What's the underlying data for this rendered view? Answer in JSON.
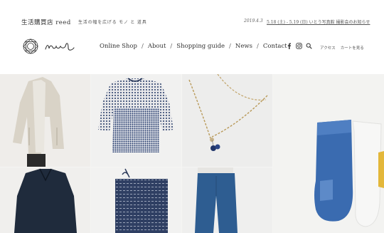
{
  "header": {
    "shop_name": "生活購買店 reed",
    "tagline": "生活の幅を広げる モノ と 道具",
    "news_date": "2019.4.3",
    "news_text": "5.18 (土) - 5.19 (日) いとう写真館 撮影会のお知らせ",
    "logo_text": "reed"
  },
  "nav": {
    "items": [
      "Online Shop",
      "About",
      "Shopping guide",
      "News",
      "Contact"
    ],
    "separator": "/"
  },
  "icons": [
    "facebook-icon",
    "instagram-icon",
    "search-icon"
  ],
  "sub_links": [
    "アクセス",
    "カートを見る"
  ],
  "gallery": {
    "tiles": [
      "linen-coat-photo",
      "dotted-blouse-photo",
      "beaded-necklace-photo",
      "socks-photo",
      "navy-shirt-photo",
      "indigo-bag-photo",
      "denim-pants-photo"
    ]
  },
  "colors": {
    "text": "#333333",
    "indigo": "#2e4a7d",
    "denim_blue": "#3a6bb0",
    "background": "#ffffff"
  }
}
